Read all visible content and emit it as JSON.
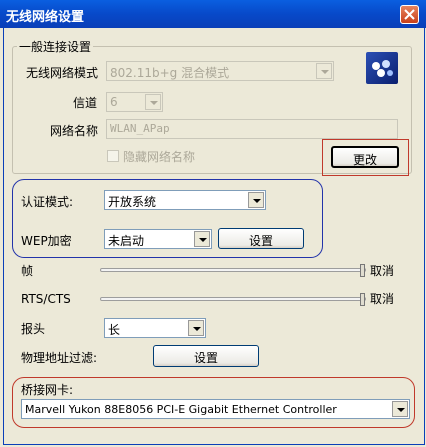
{
  "window": {
    "title": "无线网络设置"
  },
  "general": {
    "legend": "一般连接设置",
    "mode_label": "无线网络模式",
    "mode_value": "802.11b+g 混合模式",
    "channel_label": "信道",
    "channel_value": "6",
    "ssid_label": "网络名称",
    "ssid_value": "WLAN_APap",
    "hide_ssid_label": "隐藏网络名称",
    "change_button": "更改"
  },
  "auth": {
    "mode_label": "认证模式:",
    "mode_value": "开放系统",
    "wep_label": "WEP加密",
    "wep_value": "未启动",
    "settings_button": "设置"
  },
  "frame": {
    "label": "帧",
    "cancel_label": "取消"
  },
  "rts": {
    "label": "RTS/CTS",
    "cancel_label": "取消"
  },
  "preamble": {
    "label": "报头",
    "value": "长"
  },
  "mac_filter": {
    "label": "物理地址过滤:",
    "button": "设置"
  },
  "bridge": {
    "legend": "桥接网卡:",
    "adapter_value": "Marvell Yukon 88E8056 PCI-E Gigabit Ethernet Controller"
  },
  "colors": {
    "titlebar": "#0749c9",
    "highlight_red": "#c0392b",
    "highlight_blue": "#2233aa"
  }
}
